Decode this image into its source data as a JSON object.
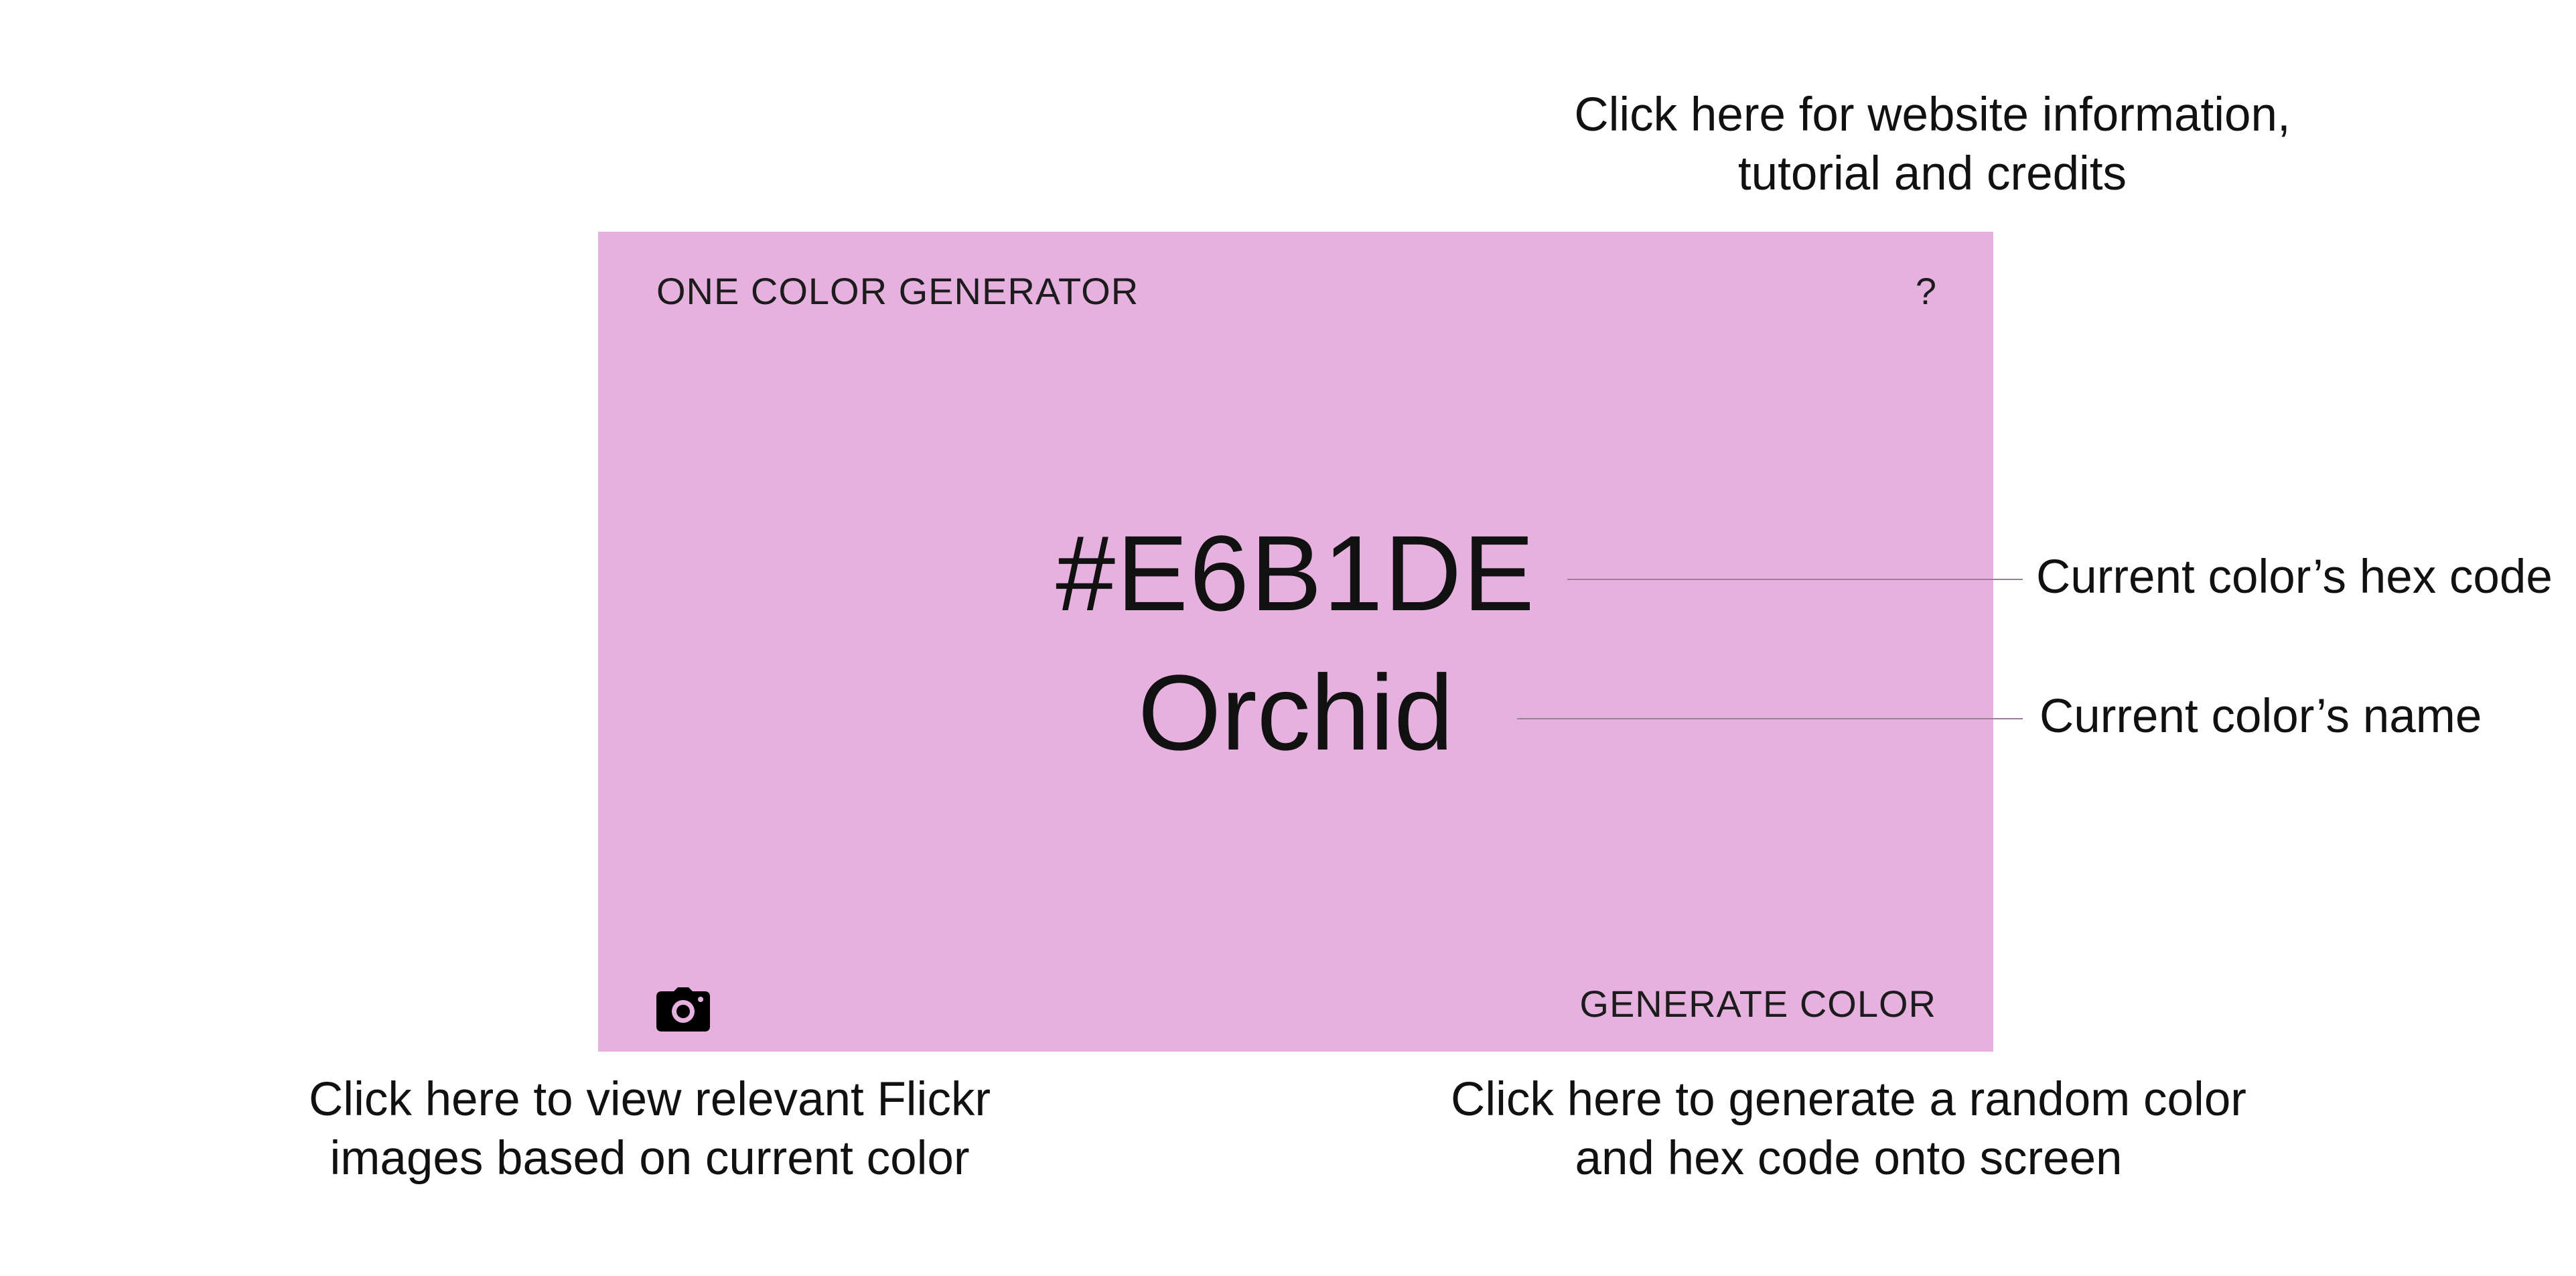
{
  "app": {
    "title": "ONE COLOR GENERATOR",
    "help_label": "?",
    "generate_label": "GENERATE COLOR",
    "background_color": "#E6B1DE"
  },
  "color": {
    "hex": "#E6B1DE",
    "name": "Orchid"
  },
  "icons": {
    "flickr_button": "camera-icon"
  },
  "annotations": {
    "info": [
      "Click here for website information,",
      "tutorial and credits"
    ],
    "hex": "Current color’s hex code",
    "name": "Current color’s name",
    "flickr": [
      "Click here to view relevant Flickr",
      "images based on current color"
    ],
    "generate": [
      "Click here to generate a random color",
      "and hex code onto screen"
    ]
  }
}
